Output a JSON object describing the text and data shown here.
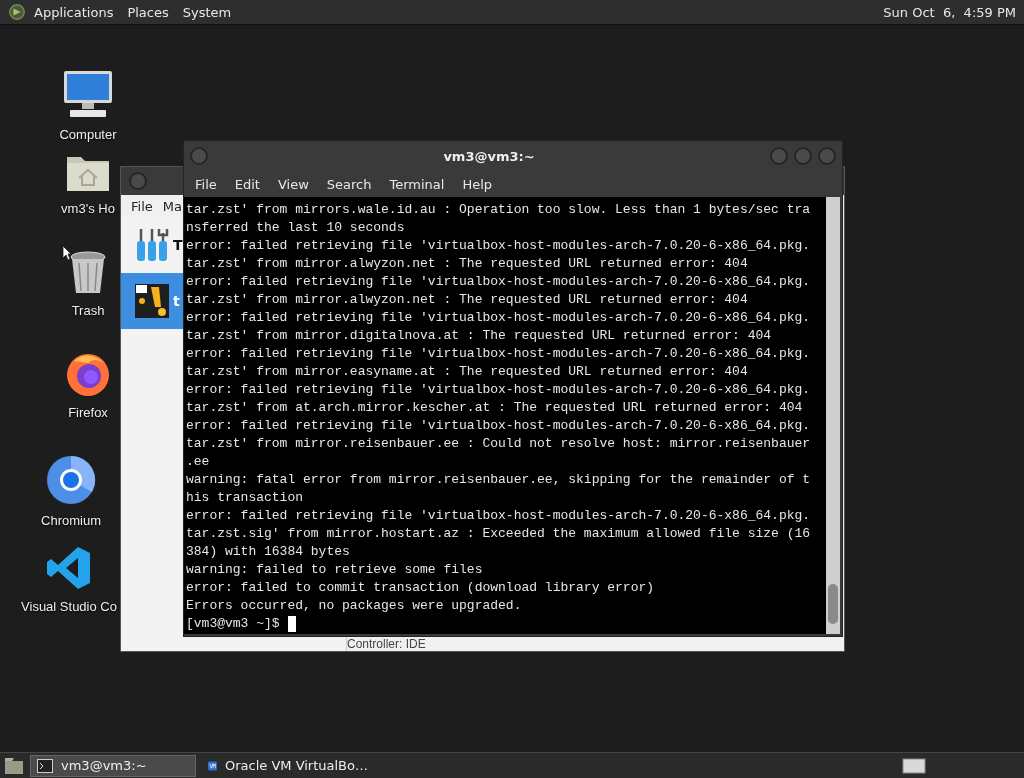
{
  "top_panel": {
    "menus": [
      "Applications",
      "Places",
      "System"
    ],
    "clock": "Sun Oct  6,  4:59 PM"
  },
  "desktop_icons": [
    {
      "kind": "computer",
      "label": "Computer"
    },
    {
      "kind": "home",
      "label": "vm3's Ho"
    },
    {
      "kind": "trash",
      "label": "Trash"
    },
    {
      "kind": "firefox",
      "label": "Firefox"
    },
    {
      "kind": "chromium",
      "label": "Chromium"
    },
    {
      "kind": "vscode",
      "label": "Visual Studio Co"
    }
  ],
  "back_window": {
    "menu": [
      "File",
      "Ma"
    ],
    "items": [
      {
        "kind": "tools",
        "label": "T",
        "selected": false
      },
      {
        "kind": "vm",
        "label": "t",
        "selected": true
      }
    ],
    "detail": "Controller: IDE"
  },
  "terminal": {
    "title": "vm3@vm3:~",
    "menu": [
      "File",
      "Edit",
      "View",
      "Search",
      "Terminal",
      "Help"
    ],
    "lines": [
      "tar.zst' from mirrors.wale.id.au : Operation too slow. Less than 1 bytes/sec tra",
      "nsferred the last 10 seconds",
      "error: failed retrieving file 'virtualbox-host-modules-arch-7.0.20-6-x86_64.pkg.",
      "tar.zst' from mirror.alwyzon.net : The requested URL returned error: 404",
      "error: failed retrieving file 'virtualbox-host-modules-arch-7.0.20-6-x86_64.pkg.",
      "tar.zst' from mirror.alwyzon.net : The requested URL returned error: 404",
      "error: failed retrieving file 'virtualbox-host-modules-arch-7.0.20-6-x86_64.pkg.",
      "tar.zst' from mirror.digitalnova.at : The requested URL returned error: 404",
      "error: failed retrieving file 'virtualbox-host-modules-arch-7.0.20-6-x86_64.pkg.",
      "tar.zst' from mirror.easyname.at : The requested URL returned error: 404",
      "error: failed retrieving file 'virtualbox-host-modules-arch-7.0.20-6-x86_64.pkg.",
      "tar.zst' from at.arch.mirror.kescher.at : The requested URL returned error: 404",
      "error: failed retrieving file 'virtualbox-host-modules-arch-7.0.20-6-x86_64.pkg.",
      "tar.zst' from mirror.reisenbauer.ee : Could not resolve host: mirror.reisenbauer",
      ".ee",
      "warning: fatal error from mirror.reisenbauer.ee, skipping for the remainder of t",
      "his transaction",
      "error: failed retrieving file 'virtualbox-host-modules-arch-7.0.20-6-x86_64.pkg.",
      "tar.zst.sig' from mirror.hostart.az : Exceeded the maximum allowed file size (16",
      "384) with 16384 bytes",
      "warning: failed to retrieve some files",
      "error: failed to commit transaction (download library error)",
      "Errors occurred, no packages were upgraded."
    ],
    "prompt": "[vm3@vm3 ~]$"
  },
  "taskbar": {
    "items": [
      {
        "kind": "terminal",
        "label": "vm3@vm3:~",
        "selected": true
      },
      {
        "kind": "virtualbox",
        "label": "Oracle VM VirtualBo…",
        "selected": false
      }
    ]
  }
}
